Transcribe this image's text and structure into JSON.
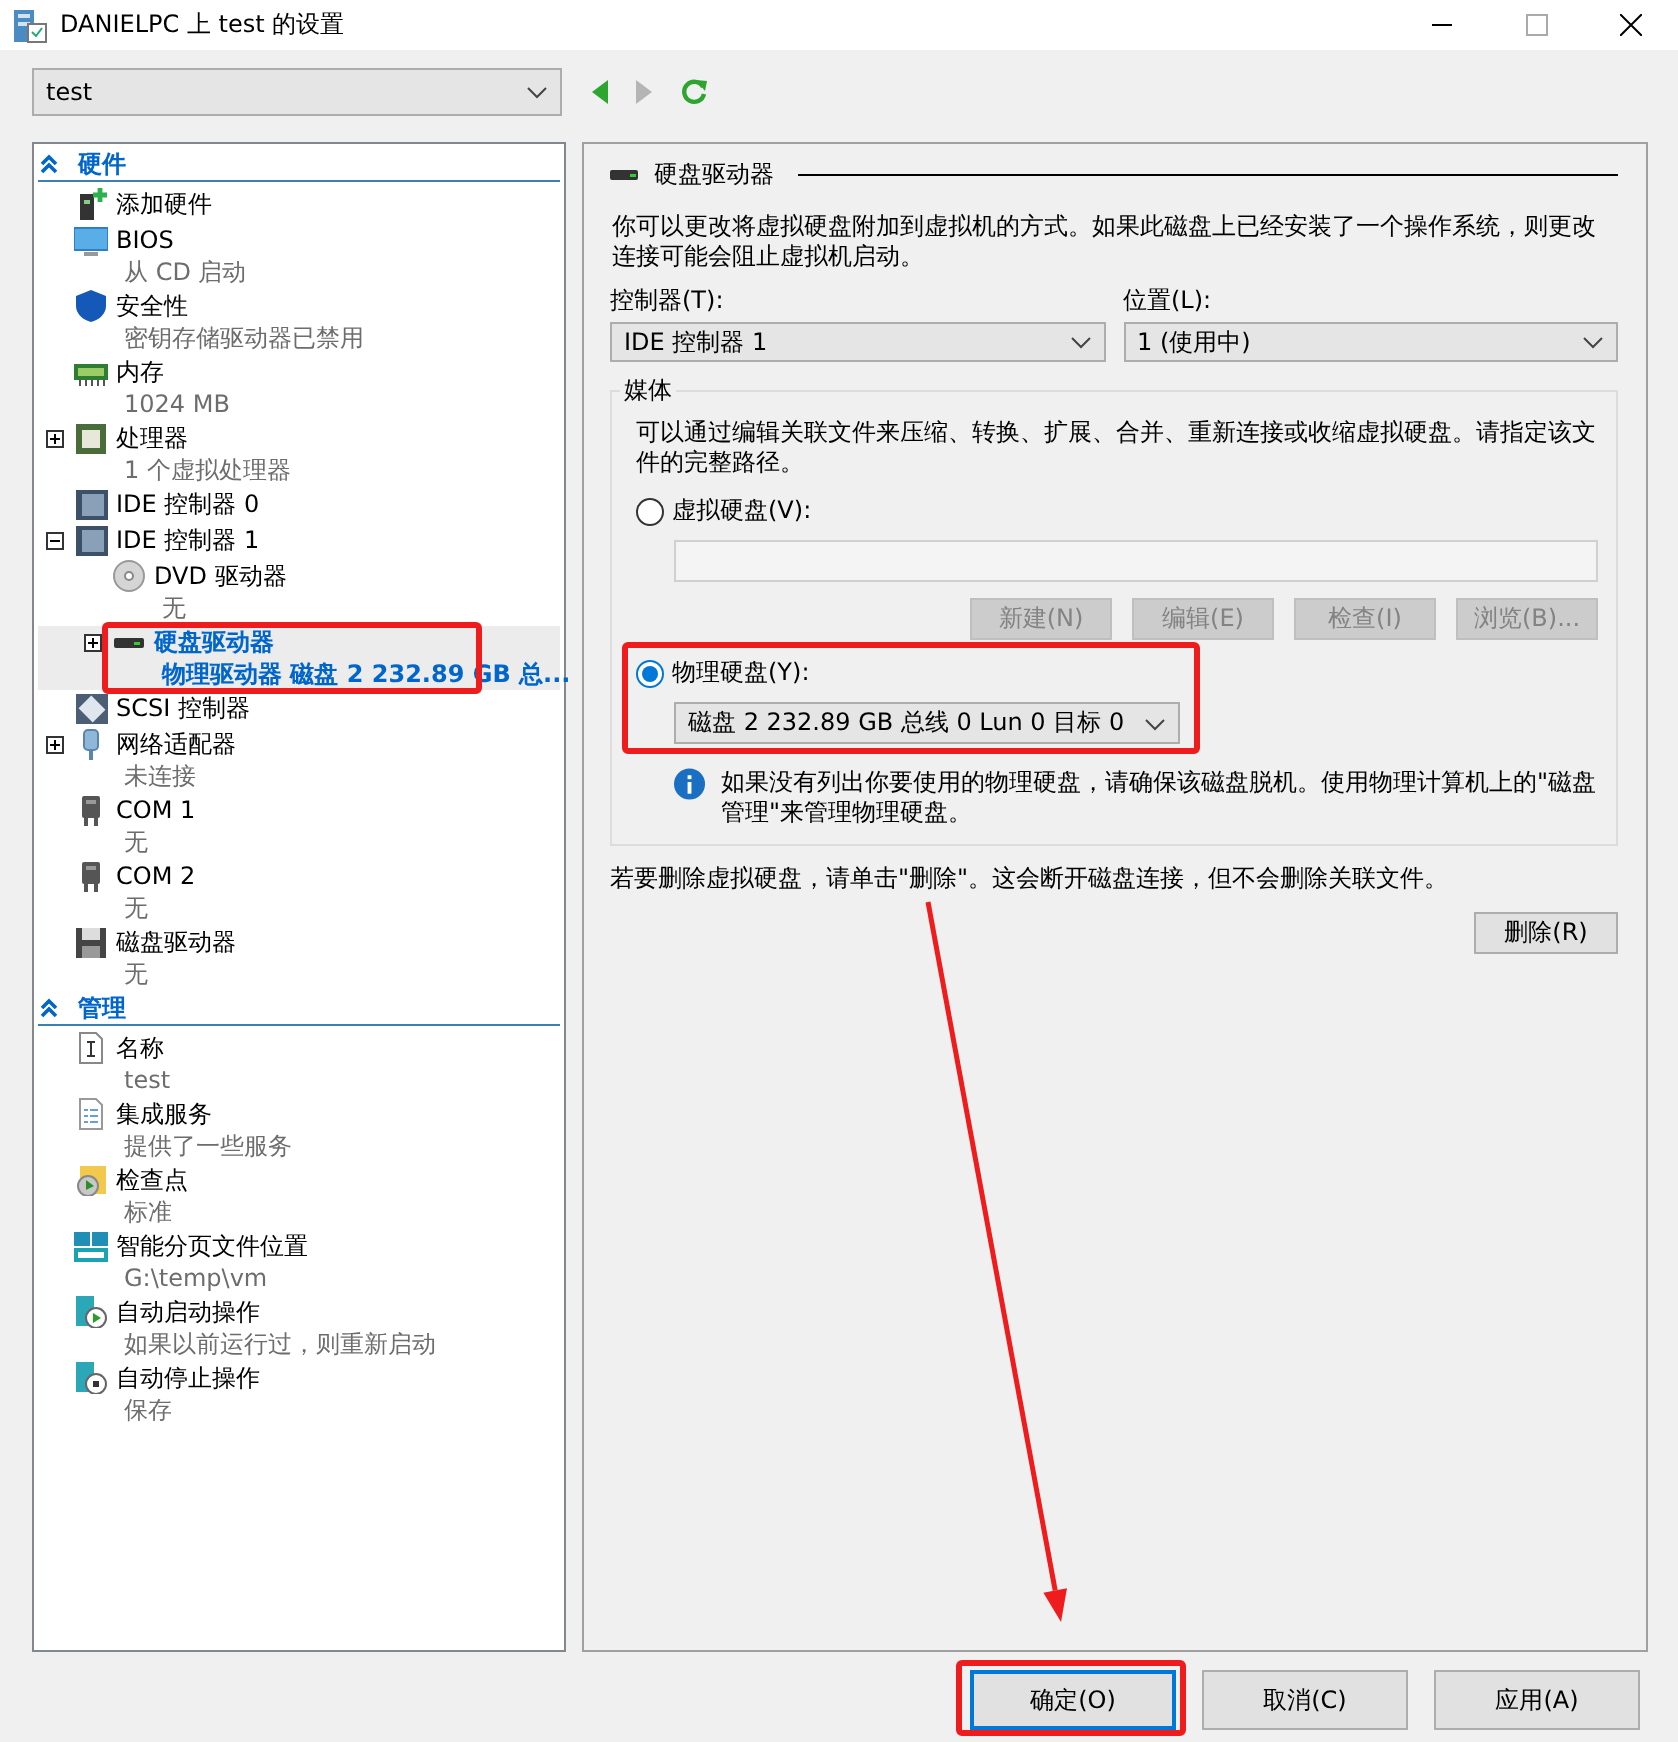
{
  "window": {
    "title": "DANIELPC 上 test 的设置"
  },
  "vm_select": {
    "value": "test"
  },
  "nav": {
    "back_enabled": true,
    "forward_enabled": false
  },
  "tree": [
    {
      "label": "硬件",
      "items": [
        {
          "kind": "add-hardware",
          "name": "添加硬件",
          "selected": false
        },
        {
          "kind": "bios",
          "name": "BIOS",
          "detail": "从 CD 启动",
          "selected": false
        },
        {
          "kind": "security",
          "name": "安全性",
          "detail": "密钥存储驱动器已禁用",
          "selected": false
        },
        {
          "kind": "memory",
          "name": "内存",
          "detail": "1024 MB",
          "selected": false
        },
        {
          "kind": "processor",
          "name": "处理器",
          "detail": "1 个虚拟处理器",
          "selected": false,
          "expanded": false
        },
        {
          "kind": "ide",
          "name": "IDE 控制器 0",
          "selected": false
        },
        {
          "kind": "ide",
          "name": "IDE 控制器 1",
          "selected": false,
          "expanded": true,
          "children": [
            {
              "kind": "dvd",
              "name": "DVD 驱动器",
              "detail": "无",
              "selected": false
            },
            {
              "kind": "hdd",
              "name": "硬盘驱动器",
              "detail": "物理驱动器 磁盘 2 232.89 GB 总...",
              "selected": true,
              "expanded": false,
              "outlined": true
            }
          ]
        },
        {
          "kind": "scsi",
          "name": "SCSI 控制器",
          "selected": false
        },
        {
          "kind": "network",
          "name": "网络适配器",
          "detail": "未连接",
          "selected": false,
          "expanded": false
        },
        {
          "kind": "com",
          "name": "COM 1",
          "detail": "无",
          "selected": false
        },
        {
          "kind": "com",
          "name": "COM 2",
          "detail": "无",
          "selected": false
        },
        {
          "kind": "floppy",
          "name": "磁盘驱动器",
          "detail": "无",
          "selected": false
        }
      ]
    },
    {
      "label": "管理",
      "items": [
        {
          "kind": "name",
          "name": "名称",
          "detail": "test",
          "selected": false
        },
        {
          "kind": "integration",
          "name": "集成服务",
          "detail": "提供了一些服务",
          "selected": false
        },
        {
          "kind": "checkpoint",
          "name": "检查点",
          "detail": "标准",
          "selected": false
        },
        {
          "kind": "paging",
          "name": "智能分页文件位置",
          "detail": "G:\\temp\\vm",
          "selected": false
        },
        {
          "kind": "autostart",
          "name": "自动启动操作",
          "detail": "如果以前运行过，则重新启动",
          "selected": false
        },
        {
          "kind": "autostop",
          "name": "自动停止操作",
          "detail": "保存",
          "selected": false
        }
      ]
    }
  ],
  "panel": {
    "title": "硬盘驱动器",
    "description": "你可以更改将虚拟硬盘附加到虚拟机的方式。如果此磁盘上已经安装了一个操作系统，则更改连接可能会阻止虚拟机启动。",
    "controller": {
      "label": "控制器(T):",
      "value": "IDE 控制器 1"
    },
    "location": {
      "label": "位置(L):",
      "value": "1 (使用中)"
    },
    "media": {
      "title": "媒体",
      "description": "可以通过编辑关联文件来压缩、转换、扩展、合并、重新连接或收缩虚拟硬盘。请指定该文件的完整路径。",
      "options": [
        {
          "kind": "virtual",
          "label": "虚拟硬盘(V):",
          "selected": false,
          "field_disabled": true,
          "buttons": [
            {
              "label": "新建(N)",
              "disabled": true
            },
            {
              "label": "编辑(E)",
              "disabled": true
            },
            {
              "label": "检查(I)",
              "disabled": true
            },
            {
              "label": "浏览(B)...",
              "disabled": true
            }
          ]
        },
        {
          "kind": "physical",
          "label": "物理硬盘(Y):",
          "selected": true,
          "value": "磁盘 2 232.89 GB 总线 0 Lun 0 目标 0",
          "outlined": true,
          "note": "如果没有列出你要使用的物理硬盘，请确保该磁盘脱机。使用物理计算机上的\"磁盘管理\"来管理物理硬盘。"
        }
      ]
    },
    "remove_note": "若要删除虚拟硬盘，请单击\"删除\"。这会断开磁盘连接，但不会删除关联文件。",
    "remove_button": "删除(R)"
  },
  "buttons": [
    {
      "label": "确定(O)",
      "default": true,
      "outlined": true,
      "arrow_to": true
    },
    {
      "label": "取消(C)",
      "default": false
    },
    {
      "label": "应用(A)",
      "default": false
    }
  ]
}
